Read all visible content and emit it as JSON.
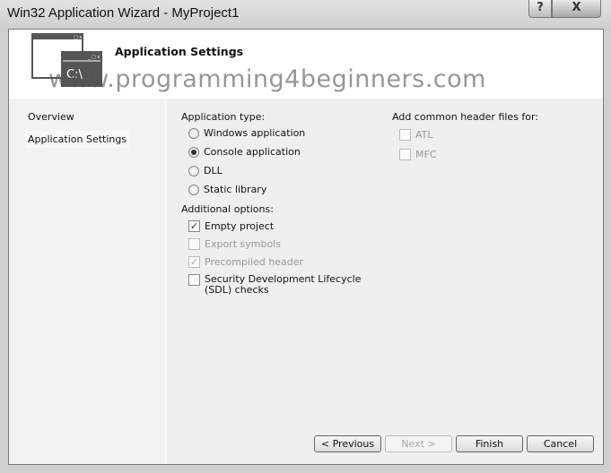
{
  "window": {
    "title": "Win32 Application Wizard - MyProject1",
    "help_label": "?",
    "close_label": "X"
  },
  "header": {
    "title": "Application Settings",
    "icon_text": "C:\\",
    "watermark": "www.programming4beginners.com"
  },
  "nav": {
    "items": [
      {
        "label": "Overview",
        "selected": false
      },
      {
        "label": "Application Settings",
        "selected": true
      }
    ]
  },
  "app_type": {
    "label": "Application type:",
    "options": [
      {
        "label": "Windows application",
        "selected": false
      },
      {
        "label": "Console application",
        "selected": true
      },
      {
        "label": "DLL",
        "selected": false
      },
      {
        "label": "Static library",
        "selected": false
      }
    ]
  },
  "additional": {
    "label": "Additional options:",
    "options": [
      {
        "label": "Empty project",
        "checked": true,
        "enabled": true
      },
      {
        "label": "Export symbols",
        "checked": false,
        "enabled": false
      },
      {
        "label": "Precompiled header",
        "checked": true,
        "enabled": false
      },
      {
        "label": "Security Development Lifecycle (SDL) checks",
        "checked": false,
        "enabled": true
      }
    ]
  },
  "headers": {
    "label": "Add common header files for:",
    "options": [
      {
        "label": "ATL",
        "checked": false,
        "enabled": false
      },
      {
        "label": "MFC",
        "checked": false,
        "enabled": false
      }
    ]
  },
  "buttons": {
    "previous": "< Previous",
    "next": "Next >",
    "finish": "Finish",
    "cancel": "Cancel"
  }
}
